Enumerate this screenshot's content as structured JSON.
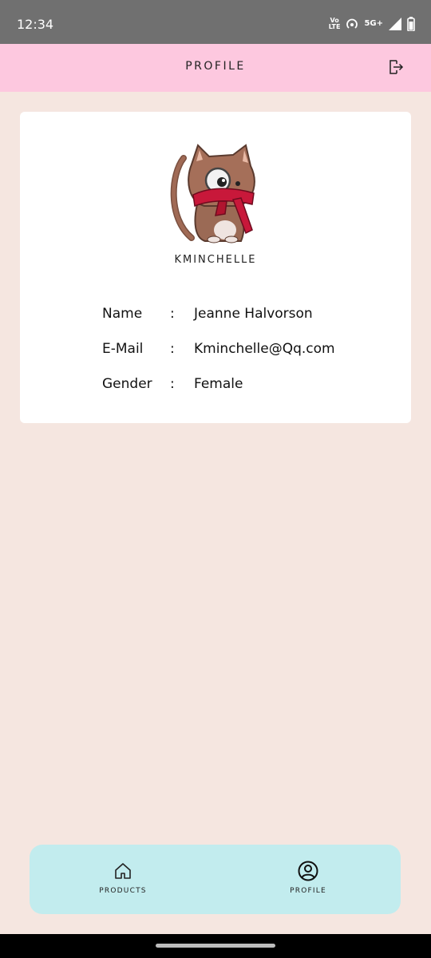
{
  "status_bar": {
    "time": "12:34",
    "volte_top": "Vo",
    "volte_bottom": "LTE",
    "network": "5G+",
    "icons": [
      "volte-icon",
      "hotspot-icon",
      "signal-icon",
      "battery-icon"
    ]
  },
  "app_bar": {
    "title": "PROFILE",
    "action_icon": "logout-icon"
  },
  "profile": {
    "avatar_icon": "cat-avatar",
    "username": "KMINCHELLE",
    "fields": [
      {
        "label": "Name",
        "separator": ":",
        "value": "Jeanne Halvorson"
      },
      {
        "label": "E-Mail",
        "separator": ":",
        "value": "Kminchelle@Qq.com"
      },
      {
        "label": "Gender",
        "separator": ":",
        "value": "Female"
      }
    ]
  },
  "bottom_nav": {
    "items": [
      {
        "label": "PRODUCTS",
        "icon": "home-icon"
      },
      {
        "label": "PROFILE",
        "icon": "account-circle-icon"
      }
    ]
  },
  "colors": {
    "background": "#f5e6e0",
    "app_bar": "#fdc8df",
    "card": "#ffffff",
    "bottom_nav": "#c2ecee",
    "status_bar": "#707070"
  }
}
